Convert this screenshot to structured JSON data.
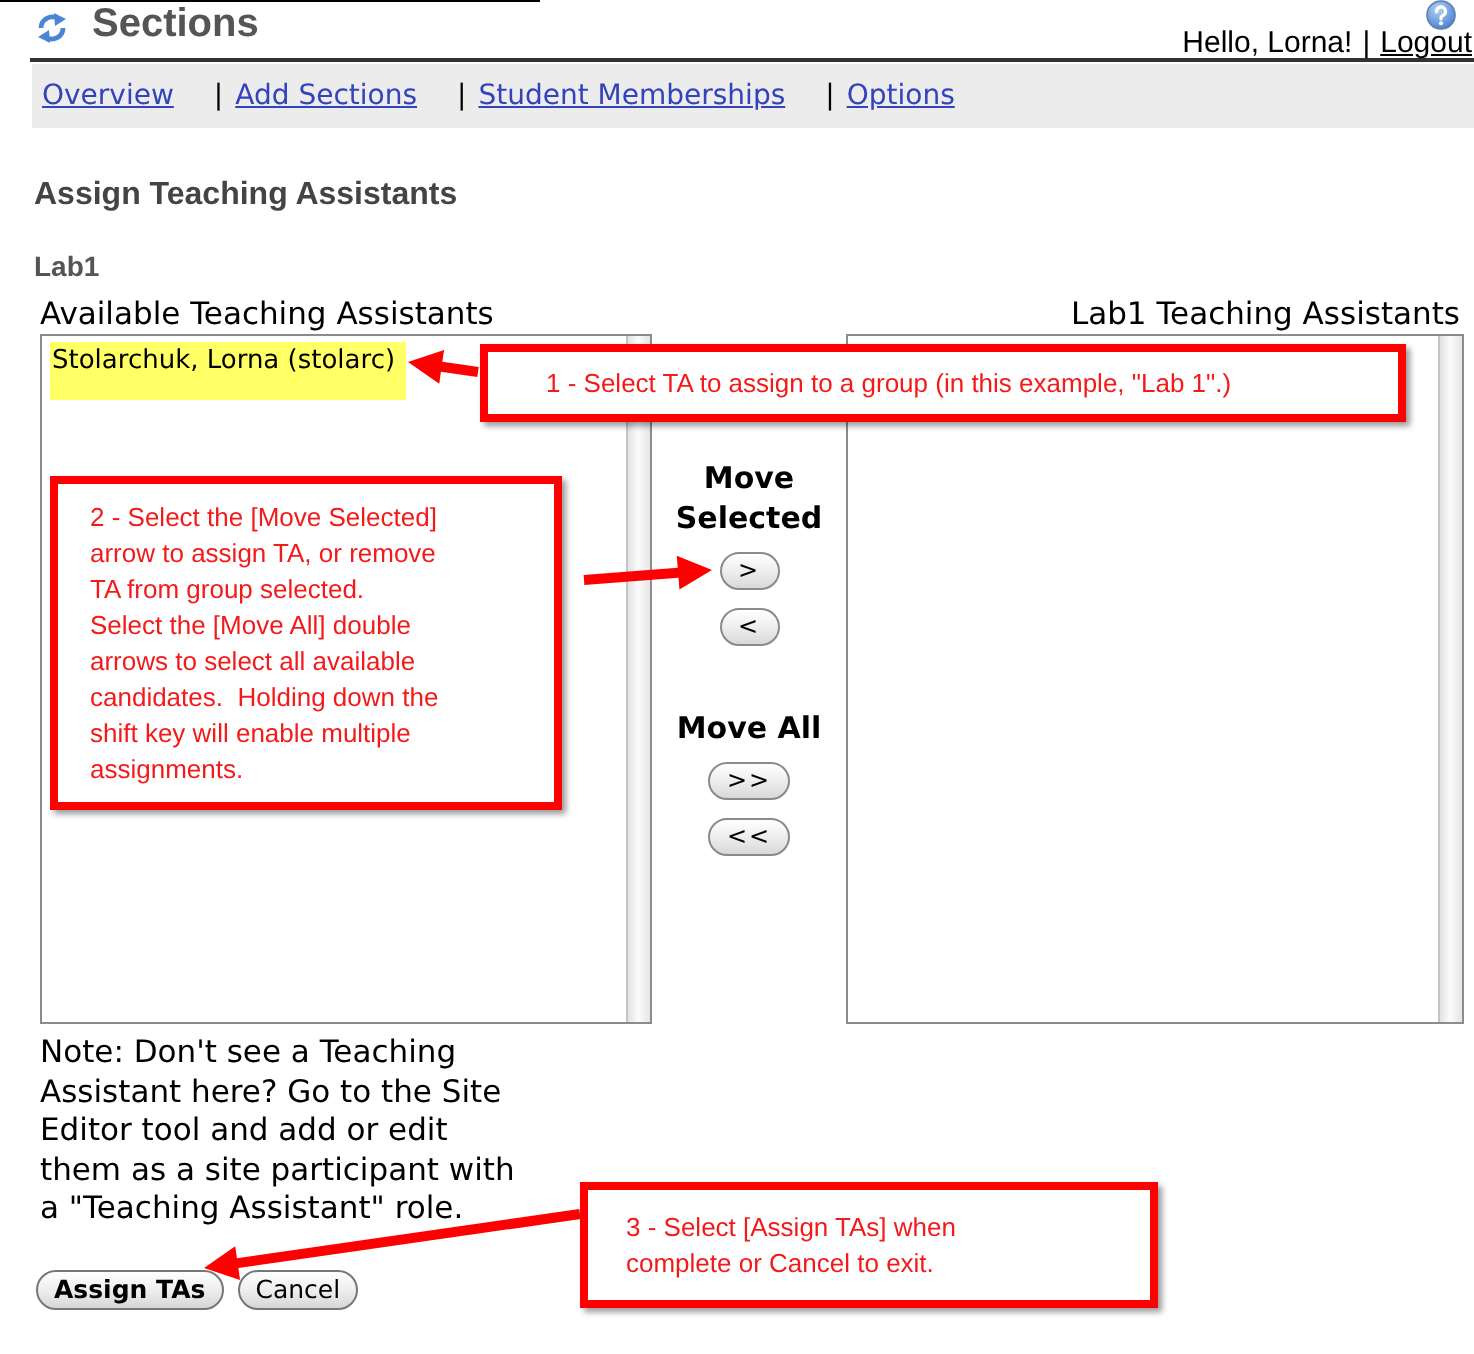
{
  "header": {
    "title": "Sections",
    "greeting": "Hello, Lorna!",
    "separator": "|",
    "logout": "Logout"
  },
  "nav": [
    {
      "label": "Overview"
    },
    {
      "separator": "|",
      "label": "Add Sections"
    },
    {
      "separator": "|",
      "label": "Student Memberships"
    },
    {
      "separator": "|",
      "label": "Options"
    }
  ],
  "page_title": "Assign Teaching Assistants",
  "group": "Lab1",
  "available_list": {
    "heading": "Available Teaching Assistants",
    "items": [
      {
        "label": "Stolarchuk, Lorna (stolarc)",
        "selected": true
      }
    ]
  },
  "group_list": {
    "heading": "Lab1 Teaching Assistants"
  },
  "move_groups": [
    {
      "heading": "Move Selected",
      "buttons": [
        ">",
        "<"
      ]
    },
    {
      "heading": "Move All",
      "buttons": [
        ">>",
        "<<"
      ]
    }
  ],
  "note": "Note: Don't see a Teaching Assistant here? Go to the Site Editor tool and add or edit them as a site participant with a \"Teaching Assistant\" role.",
  "buttons": [
    {
      "label": "Assign TAs",
      "default": true
    },
    {
      "label": "Cancel",
      "default": false
    }
  ],
  "callouts": [
    {
      "text": "1 - Select TA to assign to a group (in this example, \"Lab 1\".)"
    },
    {
      "text": "2 - Select the [Move Selected]\narrow to assign TA, or remove\nTA from group selected.\nSelect the [Move All] double\narrows to select all available\ncandidates.  Holding down the\nshift key will enable multiple\nassignments."
    },
    {
      "text": "3 - Select [Assign TAs] when\ncomplete or Cancel to exit."
    }
  ]
}
